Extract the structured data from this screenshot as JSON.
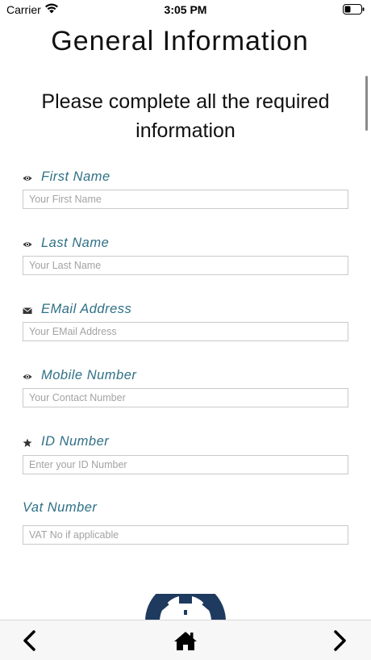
{
  "status_bar": {
    "carrier": "Carrier",
    "time": "3:05 PM"
  },
  "header": {
    "title": "General Information",
    "subtitle_line1": "Please complete all the required",
    "subtitle_line2": "information"
  },
  "form": {
    "fields": [
      {
        "label": "First Name",
        "placeholder": "Your First Name",
        "icon": "eye-icon"
      },
      {
        "label": "Last Name",
        "placeholder": "Your Last Name",
        "icon": "eye-icon"
      },
      {
        "label": "EMail Address",
        "placeholder": "Your EMail Address",
        "icon": "envelope-icon"
      },
      {
        "label": "Mobile Number",
        "placeholder": "Your Contact Number",
        "icon": "eye-icon"
      },
      {
        "label": "ID Number",
        "placeholder": "Enter your ID Number",
        "icon": "star-icon"
      },
      {
        "label": "Vat Number",
        "placeholder": "VAT No if applicable",
        "icon": ""
      }
    ]
  },
  "colors": {
    "label": "#2f7086",
    "logo": "#1e3a5f"
  },
  "bottom_nav": {
    "back_icon": "chevron-left-icon",
    "home_icon": "home-icon",
    "forward_icon": "chevron-right-icon"
  }
}
